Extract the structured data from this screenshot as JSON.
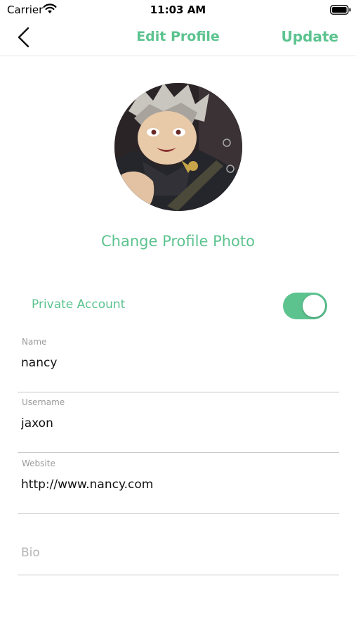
{
  "status_bar": {
    "carrier": "Carrier",
    "time": "11:03 AM",
    "wifi_icon": "wifi-icon",
    "battery_icon": "battery-icon"
  },
  "nav": {
    "back_icon": "chevron-left-icon",
    "title": "Edit Profile",
    "update_label": "Update"
  },
  "profile": {
    "avatar": "avatar-image",
    "change_photo_label": "Change Profile Photo"
  },
  "privacy": {
    "label": "Private Account",
    "enabled": true
  },
  "fields": {
    "name": {
      "label": "Name",
      "value": "nancy"
    },
    "username": {
      "label": "Username",
      "value": "jaxon"
    },
    "website": {
      "label": "Website",
      "value": "http://www.nancy.com"
    },
    "bio": {
      "placeholder": "Bio",
      "value": ""
    }
  },
  "colors": {
    "accent": "#5cc38f",
    "divider": "#c8c8c8",
    "label_gray": "#9a9a9a"
  }
}
